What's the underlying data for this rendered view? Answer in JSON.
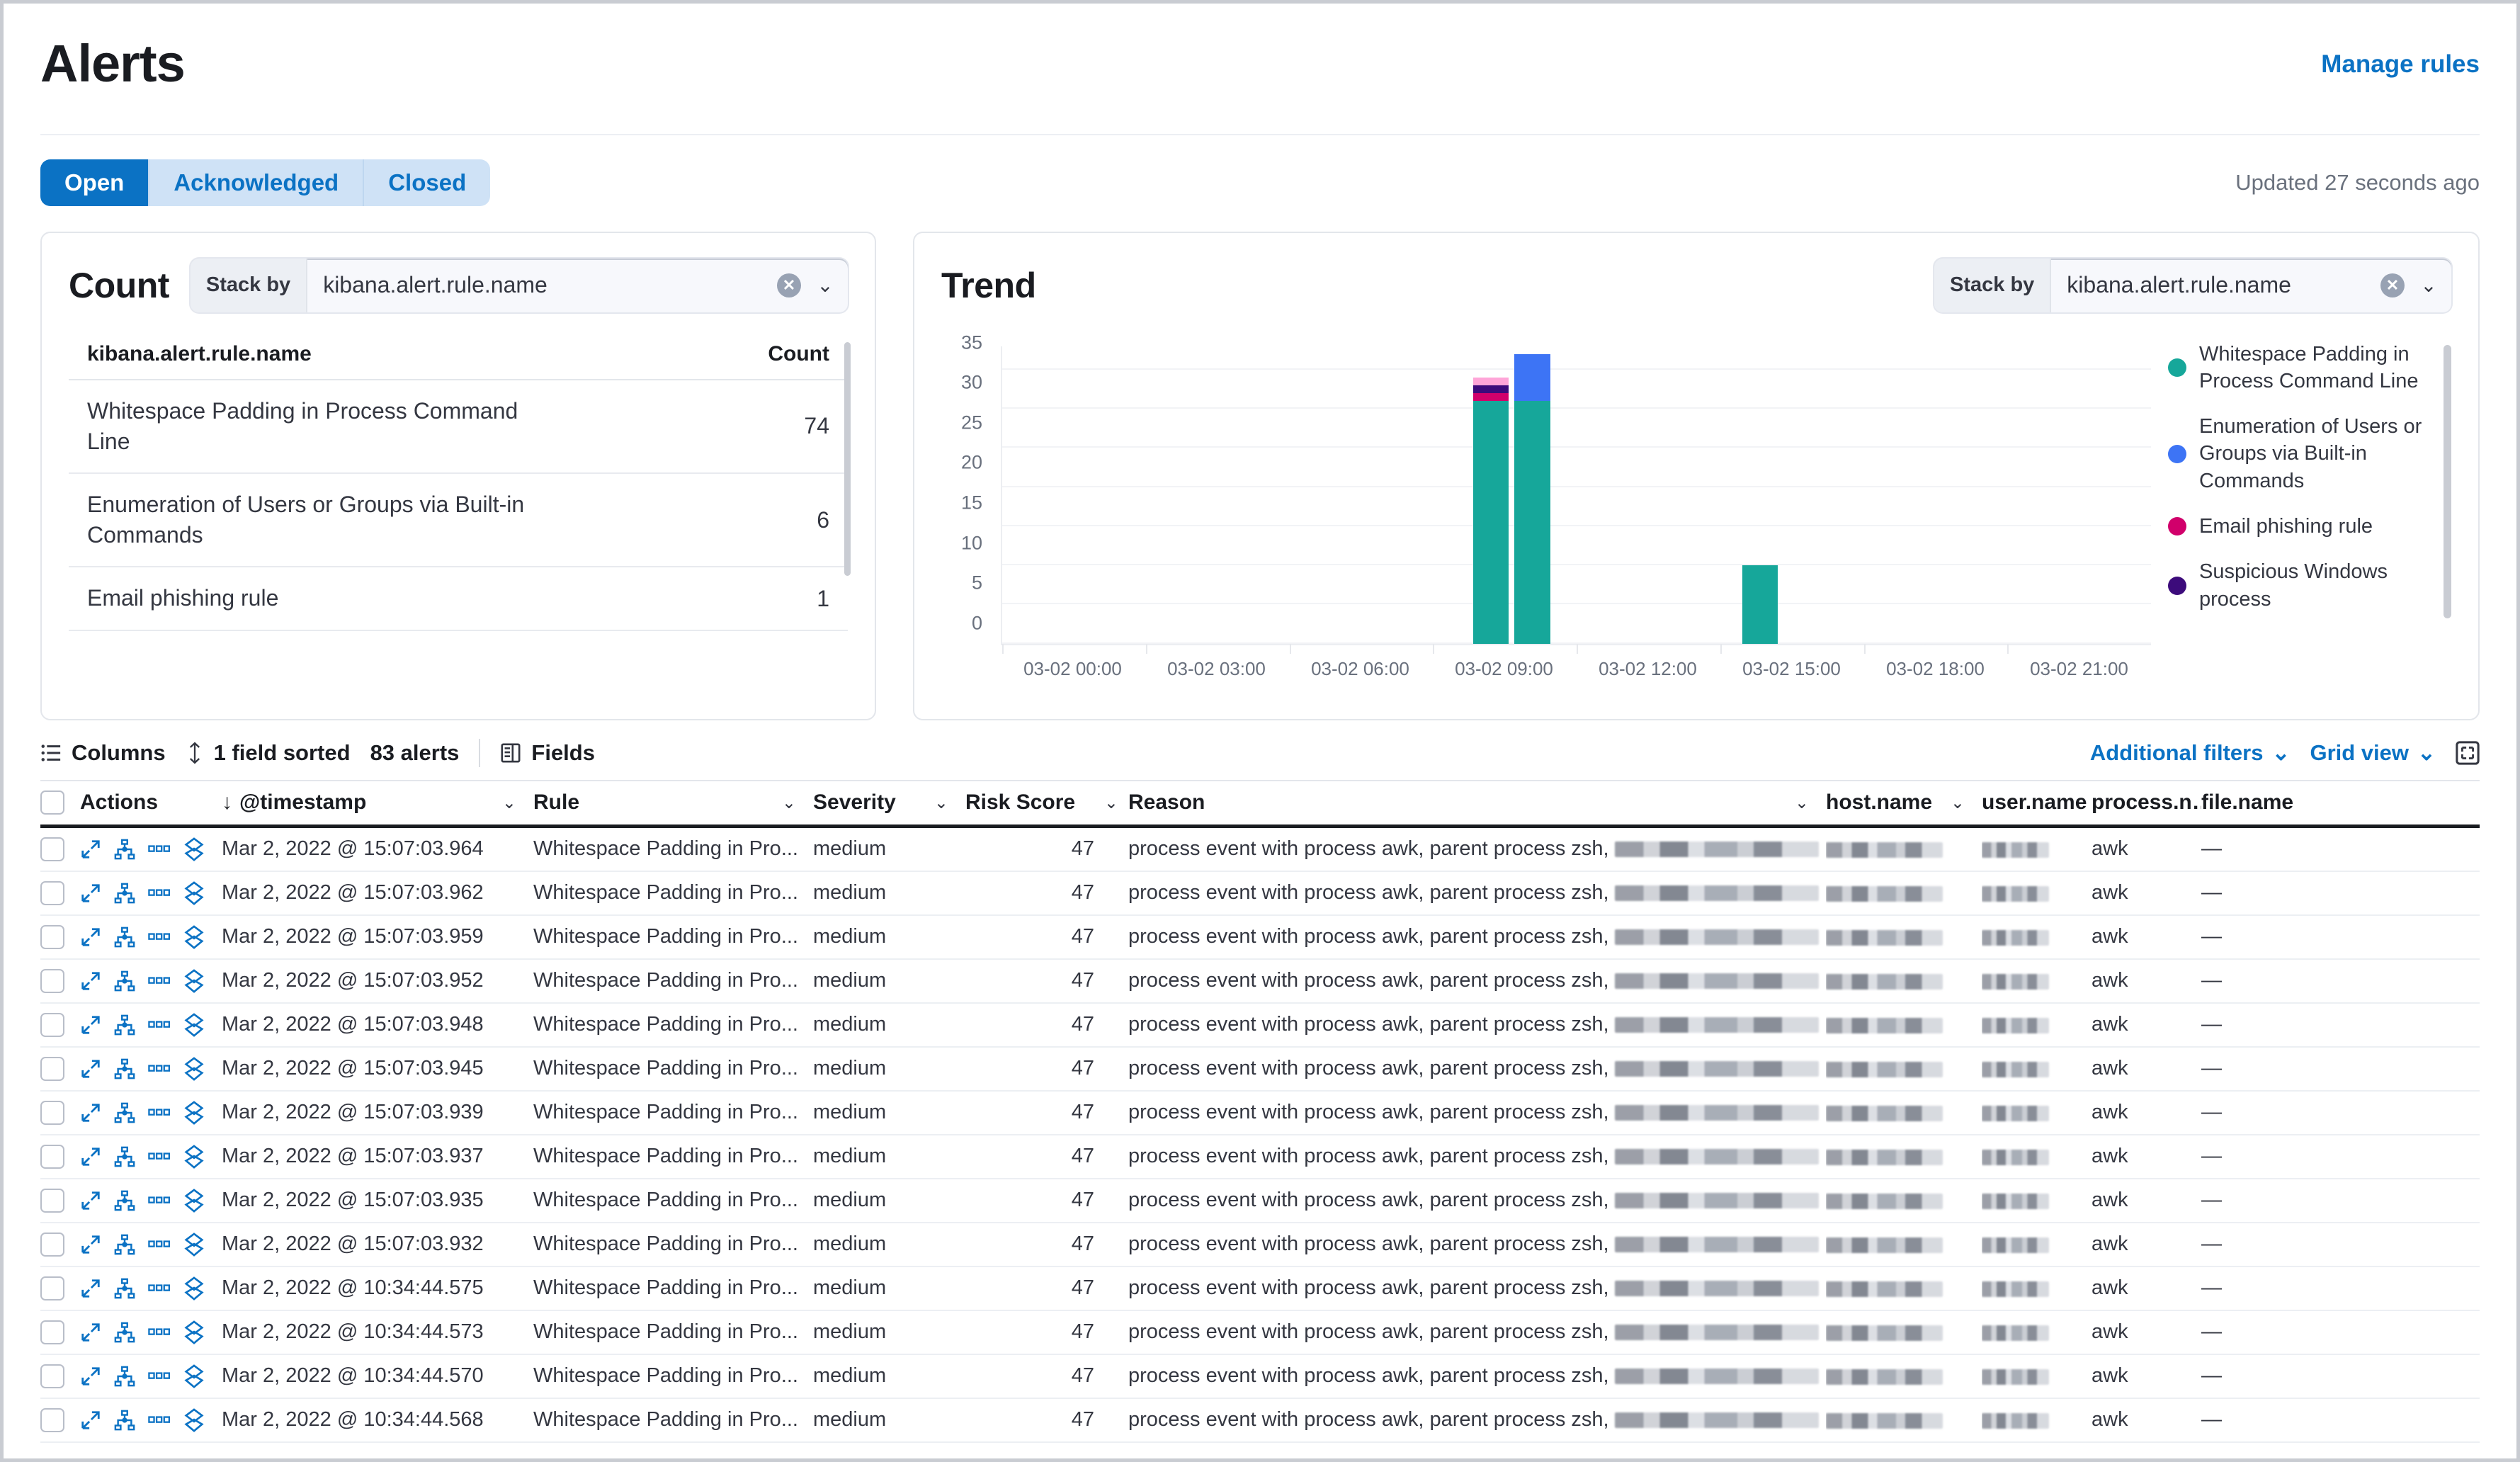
{
  "header": {
    "title": "Alerts",
    "manage_rules_label": "Manage rules"
  },
  "status_filters": {
    "items": [
      {
        "label": "Open",
        "selected": true
      },
      {
        "label": "Acknowledged",
        "selected": false
      },
      {
        "label": "Closed",
        "selected": false
      }
    ],
    "updated_text": "Updated 27 seconds ago"
  },
  "count_panel": {
    "title": "Count",
    "stack_by": {
      "label": "Stack by",
      "value": "kibana.alert.rule.name",
      "clear_icon": "cross-in-circle-icon",
      "chevron_icon": "chevron-down-icon"
    },
    "table": {
      "columns": [
        "kibana.alert.rule.name",
        "Count"
      ],
      "rows": [
        {
          "name": "Whitespace Padding in Process Command Line",
          "count": "74"
        },
        {
          "name": "Enumeration of Users or Groups via Built-in Commands",
          "count": "6"
        },
        {
          "name": "Email phishing rule",
          "count": "1"
        }
      ]
    }
  },
  "trend_panel": {
    "title": "Trend",
    "stack_by": {
      "label": "Stack by",
      "value": "kibana.alert.rule.name",
      "clear_icon": "cross-in-circle-icon",
      "chevron_icon": "chevron-down-icon"
    }
  },
  "chart_data": {
    "type": "bar",
    "title": "Trend",
    "xlabel": "",
    "ylabel": "",
    "ylim": [
      0,
      38
    ],
    "yticks": [
      0,
      5,
      10,
      15,
      20,
      25,
      30,
      35
    ],
    "xticks": [
      "03-02 00:00",
      "03-02 03:00",
      "03-02 06:00",
      "03-02 09:00",
      "03-02 12:00",
      "03-02 15:00",
      "03-02 18:00",
      "03-02 21:00"
    ],
    "stacked": true,
    "grid": true,
    "legend_position": "right",
    "colors": {
      "Whitespace Padding in Process Command Line": "#16a79a",
      "Enumeration of Users or Groups via Built-in Commands": "#3d74f5",
      "Email phishing rule": "#d1006b",
      "Suspicious Windows process": "#3c0b7b",
      "Unnamed pink": "#ffa5d8"
    },
    "legend": [
      {
        "label": "Whitespace Padding in Process Command Line",
        "color": "#16a79a"
      },
      {
        "label": "Enumeration of Users or Groups via Built-in Commands",
        "color": "#3d74f5"
      },
      {
        "label": "Email phishing rule",
        "color": "#d1006b"
      },
      {
        "label": "Suspicious Windows process",
        "color": "#3c0b7b"
      }
    ],
    "bars": [
      {
        "x": "03-02 09:00",
        "offset_pct": 41.0,
        "segments": [
          {
            "series": "Whitespace Padding in Process Command Line",
            "value": 31,
            "color": "#16a79a"
          },
          {
            "series": "Email phishing rule",
            "value": 1,
            "color": "#d1006b"
          },
          {
            "series": "Suspicious Windows process",
            "value": 1,
            "color": "#3c0b7b"
          },
          {
            "series": "Unnamed pink",
            "value": 1,
            "color": "#ffa5d8"
          }
        ]
      },
      {
        "x": "03-02 09:30",
        "offset_pct": 44.6,
        "segments": [
          {
            "series": "Whitespace Padding in Process Command Line",
            "value": 31,
            "color": "#16a79a"
          },
          {
            "series": "Enumeration of Users or Groups via Built-in Commands",
            "value": 6,
            "color": "#3d74f5"
          }
        ]
      },
      {
        "x": "03-02 15:00",
        "offset_pct": 64.4,
        "segments": [
          {
            "series": "Whitespace Padding in Process Command Line",
            "value": 10,
            "color": "#16a79a"
          }
        ]
      }
    ]
  },
  "grid_toolbar": {
    "columns_label": "Columns",
    "columns_icon": "list-icon",
    "sort_label": "1 field sorted",
    "sort_icon": "sort-updown-icon",
    "alerts_count_label": "83 alerts",
    "fields_label": "Fields",
    "fields_icon": "fields-icon",
    "additional_filters_label": "Additional filters",
    "grid_view_label": "Grid view",
    "fullscreen_icon": "fullscreen-icon"
  },
  "grid": {
    "columns": [
      {
        "key": "actions",
        "label": "Actions",
        "sort_icon": ""
      },
      {
        "key": "timestamp",
        "label": "@timestamp",
        "sort_icon": "arrow-down-icon"
      },
      {
        "key": "rule",
        "label": "Rule"
      },
      {
        "key": "severity",
        "label": "Severity"
      },
      {
        "key": "risk_score",
        "label": "Risk Score"
      },
      {
        "key": "reason",
        "label": "Reason"
      },
      {
        "key": "host_name",
        "label": "host.name"
      },
      {
        "key": "user_name",
        "label": "user.name"
      },
      {
        "key": "process_name",
        "label": "process.n…"
      },
      {
        "key": "file_name",
        "label": "file.name"
      }
    ],
    "row_action_icons": [
      "expand-icon",
      "analyzer-icon",
      "more-actions-icon",
      "session-view-icon"
    ],
    "rows": [
      {
        "timestamp": "Mar 2, 2022 @ 15:07:03.964",
        "rule": "Whitespace Padding in Pro...",
        "severity": "medium",
        "risk_score": "47",
        "reason": "process event with process awk, parent process zsh,",
        "host_name": "",
        "user_name": "",
        "process_name": "awk",
        "file_name": "—"
      },
      {
        "timestamp": "Mar 2, 2022 @ 15:07:03.962",
        "rule": "Whitespace Padding in Pro...",
        "severity": "medium",
        "risk_score": "47",
        "reason": "process event with process awk, parent process zsh,",
        "host_name": "",
        "user_name": "",
        "process_name": "awk",
        "file_name": "—"
      },
      {
        "timestamp": "Mar 2, 2022 @ 15:07:03.959",
        "rule": "Whitespace Padding in Pro...",
        "severity": "medium",
        "risk_score": "47",
        "reason": "process event with process awk, parent process zsh,",
        "host_name": "",
        "user_name": "",
        "process_name": "awk",
        "file_name": "—"
      },
      {
        "timestamp": "Mar 2, 2022 @ 15:07:03.952",
        "rule": "Whitespace Padding in Pro...",
        "severity": "medium",
        "risk_score": "47",
        "reason": "process event with process awk, parent process zsh,",
        "host_name": "",
        "user_name": "",
        "process_name": "awk",
        "file_name": "—"
      },
      {
        "timestamp": "Mar 2, 2022 @ 15:07:03.948",
        "rule": "Whitespace Padding in Pro...",
        "severity": "medium",
        "risk_score": "47",
        "reason": "process event with process awk, parent process zsh,",
        "host_name": "",
        "user_name": "",
        "process_name": "awk",
        "file_name": "—"
      },
      {
        "timestamp": "Mar 2, 2022 @ 15:07:03.945",
        "rule": "Whitespace Padding in Pro...",
        "severity": "medium",
        "risk_score": "47",
        "reason": "process event with process awk, parent process zsh,",
        "host_name": "",
        "user_name": "",
        "process_name": "awk",
        "file_name": "—"
      },
      {
        "timestamp": "Mar 2, 2022 @ 15:07:03.939",
        "rule": "Whitespace Padding in Pro...",
        "severity": "medium",
        "risk_score": "47",
        "reason": "process event with process awk, parent process zsh,",
        "host_name": "",
        "user_name": "",
        "process_name": "awk",
        "file_name": "—"
      },
      {
        "timestamp": "Mar 2, 2022 @ 15:07:03.937",
        "rule": "Whitespace Padding in Pro...",
        "severity": "medium",
        "risk_score": "47",
        "reason": "process event with process awk, parent process zsh,",
        "host_name": "",
        "user_name": "",
        "process_name": "awk",
        "file_name": "—"
      },
      {
        "timestamp": "Mar 2, 2022 @ 15:07:03.935",
        "rule": "Whitespace Padding in Pro...",
        "severity": "medium",
        "risk_score": "47",
        "reason": "process event with process awk, parent process zsh,",
        "host_name": "",
        "user_name": "",
        "process_name": "awk",
        "file_name": "—"
      },
      {
        "timestamp": "Mar 2, 2022 @ 15:07:03.932",
        "rule": "Whitespace Padding in Pro...",
        "severity": "medium",
        "risk_score": "47",
        "reason": "process event with process awk, parent process zsh,",
        "host_name": "",
        "user_name": "",
        "process_name": "awk",
        "file_name": "—"
      },
      {
        "timestamp": "Mar 2, 2022 @ 10:34:44.575",
        "rule": "Whitespace Padding in Pro...",
        "severity": "medium",
        "risk_score": "47",
        "reason": "process event with process awk, parent process zsh,",
        "host_name": "",
        "user_name": "",
        "process_name": "awk",
        "file_name": "—"
      },
      {
        "timestamp": "Mar 2, 2022 @ 10:34:44.573",
        "rule": "Whitespace Padding in Pro...",
        "severity": "medium",
        "risk_score": "47",
        "reason": "process event with process awk, parent process zsh,",
        "host_name": "",
        "user_name": "",
        "process_name": "awk",
        "file_name": "—"
      },
      {
        "timestamp": "Mar 2, 2022 @ 10:34:44.570",
        "rule": "Whitespace Padding in Pro...",
        "severity": "medium",
        "risk_score": "47",
        "reason": "process event with process awk, parent process zsh,",
        "host_name": "",
        "user_name": "",
        "process_name": "awk",
        "file_name": "—"
      },
      {
        "timestamp": "Mar 2, 2022 @ 10:34:44.568",
        "rule": "Whitespace Padding in Pro...",
        "severity": "medium",
        "risk_score": "47",
        "reason": "process event with process awk, parent process zsh,",
        "host_name": "",
        "user_name": "",
        "process_name": "awk",
        "file_name": "—"
      }
    ]
  }
}
